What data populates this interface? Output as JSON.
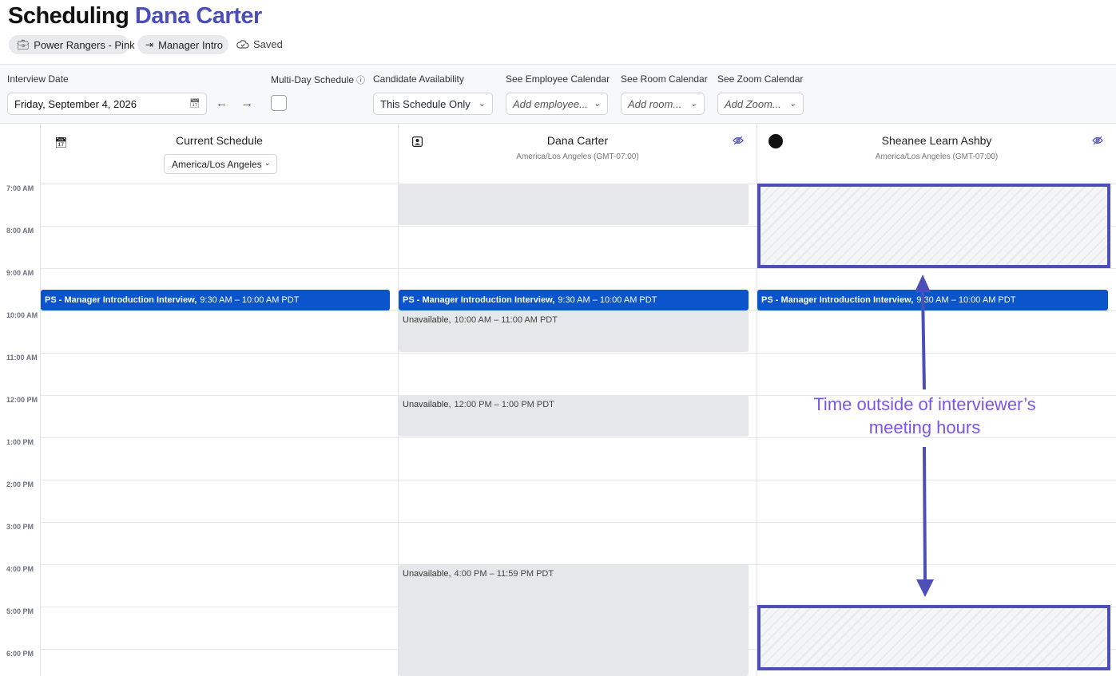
{
  "header": {
    "title_prefix": "Scheduling",
    "title_name": "Dana Carter",
    "pill_job": "Power Rangers - Pink",
    "pill_stage": "Manager Intro",
    "saved": "Saved"
  },
  "toolbar": {
    "date_label": "Interview Date",
    "date_value": "Friday, September 4, 2026",
    "multiday_label": "Multi-Day Schedule",
    "candidate_label": "Candidate Availability",
    "candidate_value": "This Schedule Only",
    "employee_label": "See Employee Calendar",
    "employee_placeholder": "Add employee...",
    "room_label": "See Room Calendar",
    "room_placeholder": "Add room...",
    "zoom_label": "See Zoom Calendar",
    "zoom_placeholder": "Add Zoom..."
  },
  "time_labels": [
    "7:00 AM",
    "8:00 AM",
    "9:00 AM",
    "10:00 AM",
    "11:00 AM",
    "12:00 PM",
    "1:00 PM",
    "2:00 PM",
    "3:00 PM",
    "4:00 PM",
    "5:00 PM",
    "6:00 PM"
  ],
  "columns": {
    "current": {
      "title": "Current Schedule",
      "timezone": "America/Los Angeles"
    },
    "dana": {
      "title": "Dana Carter",
      "subtitle": "America/Los Angeles (GMT-07:00)"
    },
    "sheanee": {
      "title": "Sheanee Learn Ashby",
      "subtitle": "America/Los Angeles (GMT-07:00)"
    }
  },
  "event": {
    "name": "PS - Manager Introduction Interview,",
    "time": "9:30 AM – 10:00 AM PDT"
  },
  "unavailable": [
    {
      "label": "Unavailable,",
      "time": "10:00 AM – 11:00 AM PDT"
    },
    {
      "label": "Unavailable,",
      "time": "12:00 PM – 1:00 PM PDT"
    },
    {
      "label": "Unavailable,",
      "time": "4:00 PM – 11:59 PM PDT"
    }
  ],
  "annotation": {
    "line1": "Time outside of interviewer’s",
    "line2": "meeting hours"
  },
  "colors": {
    "accent": "#4c4fb8",
    "event_blue": "#0b55cc",
    "annotation_purple": "#7b55e8",
    "unavailable_gray": "#e6e7ea"
  }
}
